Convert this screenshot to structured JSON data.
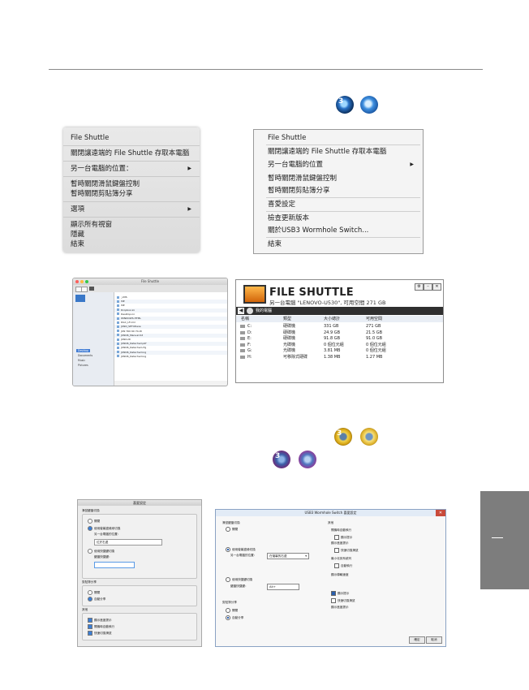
{
  "tray_icons_top": [
    "shuttle-dark-icon",
    "shuttle-light-icon"
  ],
  "mac_menu": {
    "items": [
      {
        "label": "File Shuttle",
        "submenu": false
      },
      {
        "label": "關閉讓遠端的 File Shuttle 存取本電腦",
        "submenu": false
      },
      {
        "label": "另一台電腦的位置：",
        "submenu": true
      },
      {
        "label": "暫時關閉滑鼠鍵盤控制",
        "submenu": false
      },
      {
        "label": "暫時關閉剪貼簿分享",
        "submenu": false
      },
      {
        "label": "選項",
        "submenu": true
      },
      {
        "label": "顯示所有視窗",
        "submenu": false
      },
      {
        "label": "隱藏",
        "submenu": false
      },
      {
        "label": "結束",
        "submenu": false
      }
    ]
  },
  "win_menu": {
    "items": [
      {
        "label": "File Shuttle",
        "submenu": false
      },
      {
        "label": "關閉讓遠端的 File Shuttle 存取本電腦",
        "submenu": false
      },
      {
        "label": "另一台電腦的位置",
        "submenu": true
      },
      {
        "label": "暫時關閉滑鼠鍵盤控制",
        "submenu": false
      },
      {
        "label": "暫時關閉剪貼簿分享",
        "submenu": false
      },
      {
        "label": "喜愛設定",
        "submenu": false
      },
      {
        "label": "檢查更新版本",
        "submenu": false
      },
      {
        "label": "關於USB3 Wormhole Switch...",
        "submenu": false
      },
      {
        "label": "結束",
        "submenu": false
      }
    ]
  },
  "finder": {
    "title": "File Shuttle",
    "sidebar": [
      "Desktop",
      "Documents",
      "Music",
      "Pictures"
    ],
    "rows": [
      "_LMS",
      "ISE",
      "ISE",
      "Dropbox.ini",
      "Desktop.ini",
      "WINDOWS.HTML",
      "DGC_LF.xml",
      "JUNO_SETUP.exe",
      "JUN 760 60 70.dll",
      "JUNO6_Manual.txt",
      "JUNO.dll",
      "JUNO6_Detached.pdf",
      "JUNO6_Detached.cfg",
      "JUNO6_Detached.log",
      "JUNO6_Detached.log"
    ]
  },
  "win_shuttle": {
    "title": "FILE SHUTTLE",
    "subtitle": "另一台電腦 \"LENOVO-U530\", 可用空間 271 GB",
    "nav_label": "我的電腦",
    "columns": [
      "名稱",
      "類型",
      "大小總計",
      "可用空間"
    ],
    "rows": [
      {
        "name": "C:",
        "type": "硬碟機",
        "total": "331 GB",
        "free": "271 GB"
      },
      {
        "name": "D:",
        "type": "硬碟機",
        "total": "24.9 GB",
        "free": "21.5 GB"
      },
      {
        "name": "E:",
        "type": "硬碟機",
        "total": "91.8 GB",
        "free": "91.0 GB"
      },
      {
        "name": "F:",
        "type": "光碟機",
        "total": "0 個位元組",
        "free": "0 個位元組"
      },
      {
        "name": "G:",
        "type": "光碟機",
        "total": "3.81 MB",
        "free": "0 個位元組"
      },
      {
        "name": "H:",
        "type": "可移除式硬碟",
        "total": "1.38 MB",
        "free": "1.27 MB"
      }
    ]
  },
  "tray_icons_middle": [
    "shuttle-yellow-icon",
    "shuttle-yellow-light-icon"
  ],
  "tray_icons_lower": [
    "shuttle-blocked-dark-icon",
    "shuttle-blocked-light-icon"
  ],
  "badge_number": "3",
  "mac_prefs": {
    "title": "喜愛設定",
    "section1": "滑鼠鍵盤切換",
    "opt_off": "關閉",
    "opt_use": "使用螢幕邊緣來切換",
    "position_label": "另一台電腦的位置：",
    "position_value": "位於右邊",
    "opt_hotkey": "使用快捷鍵切換",
    "hotkey_label": "鍵盤快捷鍵：",
    "hotkey_value": "",
    "section2": "剪貼簿分享",
    "share_off": "關閉",
    "share_auto": "自動分享",
    "section3": "其他",
    "check1": "顯示進度提示",
    "check2": "開機時自動執行",
    "check3": "快速切換滑鼠"
  },
  "win_prefs": {
    "title": "USB3 Wormhole Switch 喜愛設定",
    "section1": "滑鼠鍵盤切換",
    "opt_off": "關閉",
    "opt_edge": "使用螢幕邊緣切換",
    "position_label": "另一台電腦的位置：",
    "position_value": "在螢幕的右邊",
    "opt_hotkey": "使用快捷鍵切換",
    "hotkey_label": "鍵盤快捷鍵：",
    "hotkey_value": "Alt+",
    "section2": "剪貼簿分享",
    "share_off": "關閉",
    "share_auto": "自動分享",
    "section3": "其他",
    "right1": "開機時自動執行",
    "right2": "顯示提示",
    "right3": "顯示進度提示",
    "right4": "快速切換滑鼠",
    "right5": "最小化到系統列",
    "right6": "自動執行",
    "right7": "顯示傳輸速度",
    "ok": "確定",
    "cancel": "取消"
  }
}
